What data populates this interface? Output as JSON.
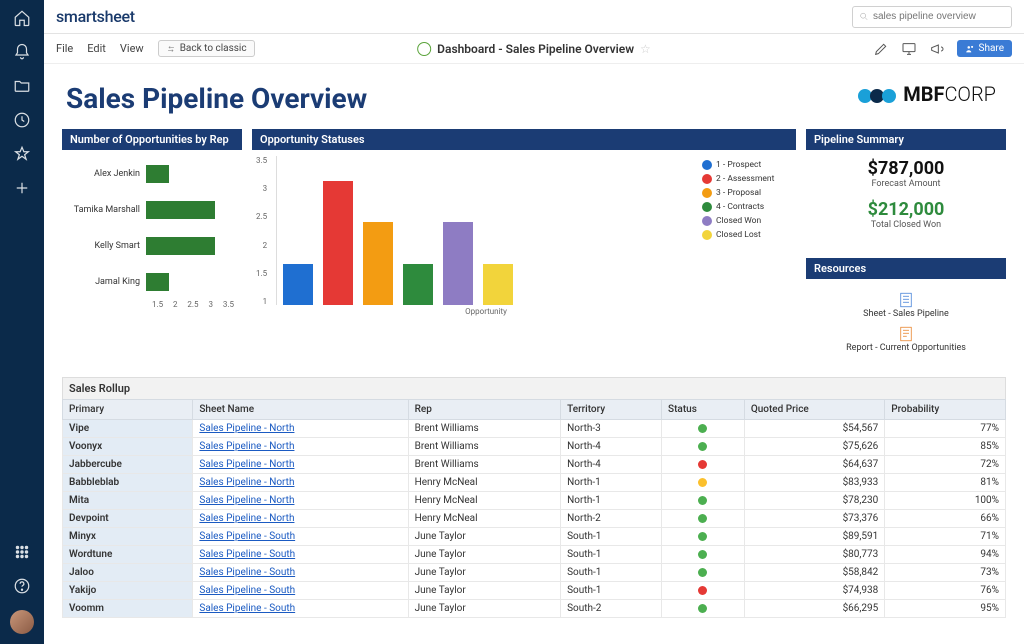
{
  "brand": "smartsheet",
  "search": {
    "placeholder": "sales pipeline overview"
  },
  "menu": {
    "file": "File",
    "edit": "Edit",
    "view": "View",
    "back": "Back to classic"
  },
  "header": {
    "title": "Dashboard - Sales Pipeline Overview",
    "share": "Share"
  },
  "page": {
    "title": "Sales Pipeline Overview"
  },
  "logo": {
    "text_bold": "MBF",
    "text_light": "CORP"
  },
  "widgets": {
    "reps": "Number of Opportunities by Rep",
    "statuses": "Opportunity Statuses",
    "summary": "Pipeline Summary",
    "resources": "Resources",
    "rollup": "Sales Rollup"
  },
  "summary": {
    "forecast_value": "$787,000",
    "forecast_label": "Forecast Amount",
    "won_value": "$212,000",
    "won_label": "Total Closed Won"
  },
  "resources": {
    "sheet": "Sheet - Sales Pipeline",
    "report": "Report - Current Opportunities"
  },
  "chart_data": [
    {
      "type": "bar",
      "orientation": "horizontal",
      "title": "Number of Opportunities by Rep",
      "categories": [
        "Alex Jenkin",
        "Tamika Marshall",
        "Kelly Smart",
        "Jamal King"
      ],
      "values": [
        2,
        3,
        3,
        2
      ],
      "xlim": [
        1.5,
        3.5
      ],
      "ticks": [
        "1.5",
        "2",
        "2.5",
        "3",
        "3.5"
      ],
      "color": "#2e7d32"
    },
    {
      "type": "bar",
      "orientation": "vertical",
      "title": "Opportunity Statuses",
      "xlabel": "Opportunity",
      "ylim": [
        0,
        3.5
      ],
      "yticks": [
        "3.5",
        "3",
        "2.5",
        "2",
        "1.5",
        "1"
      ],
      "series": [
        {
          "name": "1 - Prospect",
          "value": 1,
          "color": "#1f6fd1"
        },
        {
          "name": "2 - Assessment",
          "value": 3,
          "color": "#e53935"
        },
        {
          "name": "3 - Proposal",
          "value": 2,
          "color": "#f39c12"
        },
        {
          "name": "4 - Contracts",
          "value": 1,
          "color": "#2e8b3d"
        },
        {
          "name": "Closed Won",
          "value": 2,
          "color": "#8e7cc3"
        },
        {
          "name": "Closed Lost",
          "value": 1,
          "color": "#f2d43b"
        }
      ]
    }
  ],
  "table": {
    "columns": [
      "Primary",
      "Sheet Name",
      "Rep",
      "Territory",
      "Status",
      "Quoted Price",
      "Probability"
    ],
    "rows": [
      {
        "primary": "Vipe",
        "sheet": "Sales Pipeline - North",
        "rep": "Brent Williams",
        "territory": "North-3",
        "status": "green",
        "price": "$54,567",
        "prob": "77%"
      },
      {
        "primary": "Voonyx",
        "sheet": "Sales Pipeline - North",
        "rep": "Brent Williams",
        "territory": "North-4",
        "status": "green",
        "price": "$75,626",
        "prob": "85%"
      },
      {
        "primary": "Jabbercube",
        "sheet": "Sales Pipeline - North",
        "rep": "Brent Williams",
        "territory": "North-4",
        "status": "red",
        "price": "$64,637",
        "prob": "72%"
      },
      {
        "primary": "Babbleblab",
        "sheet": "Sales Pipeline - North",
        "rep": "Henry McNeal",
        "territory": "North-1",
        "status": "yellow",
        "price": "$83,933",
        "prob": "81%"
      },
      {
        "primary": "Mita",
        "sheet": "Sales Pipeline - North",
        "rep": "Henry McNeal",
        "territory": "North-1",
        "status": "green",
        "price": "$78,230",
        "prob": "100%"
      },
      {
        "primary": "Devpoint",
        "sheet": "Sales Pipeline - North",
        "rep": "Henry McNeal",
        "territory": "North-2",
        "status": "green",
        "price": "$73,376",
        "prob": "66%"
      },
      {
        "primary": "Minyx",
        "sheet": "Sales Pipeline - South",
        "rep": "June Taylor",
        "territory": "South-1",
        "status": "green",
        "price": "$89,591",
        "prob": "71%"
      },
      {
        "primary": "Wordtune",
        "sheet": "Sales Pipeline - South",
        "rep": "June Taylor",
        "territory": "South-1",
        "status": "green",
        "price": "$80,773",
        "prob": "94%"
      },
      {
        "primary": "Jaloo",
        "sheet": "Sales Pipeline - South",
        "rep": "June Taylor",
        "territory": "South-1",
        "status": "green",
        "price": "$58,842",
        "prob": "73%"
      },
      {
        "primary": "Yakijo",
        "sheet": "Sales Pipeline - South",
        "rep": "June Taylor",
        "territory": "South-1",
        "status": "red",
        "price": "$74,938",
        "prob": "76%"
      },
      {
        "primary": "Voomm",
        "sheet": "Sales Pipeline - South",
        "rep": "June Taylor",
        "territory": "South-2",
        "status": "green",
        "price": "$66,295",
        "prob": "95%"
      }
    ]
  }
}
